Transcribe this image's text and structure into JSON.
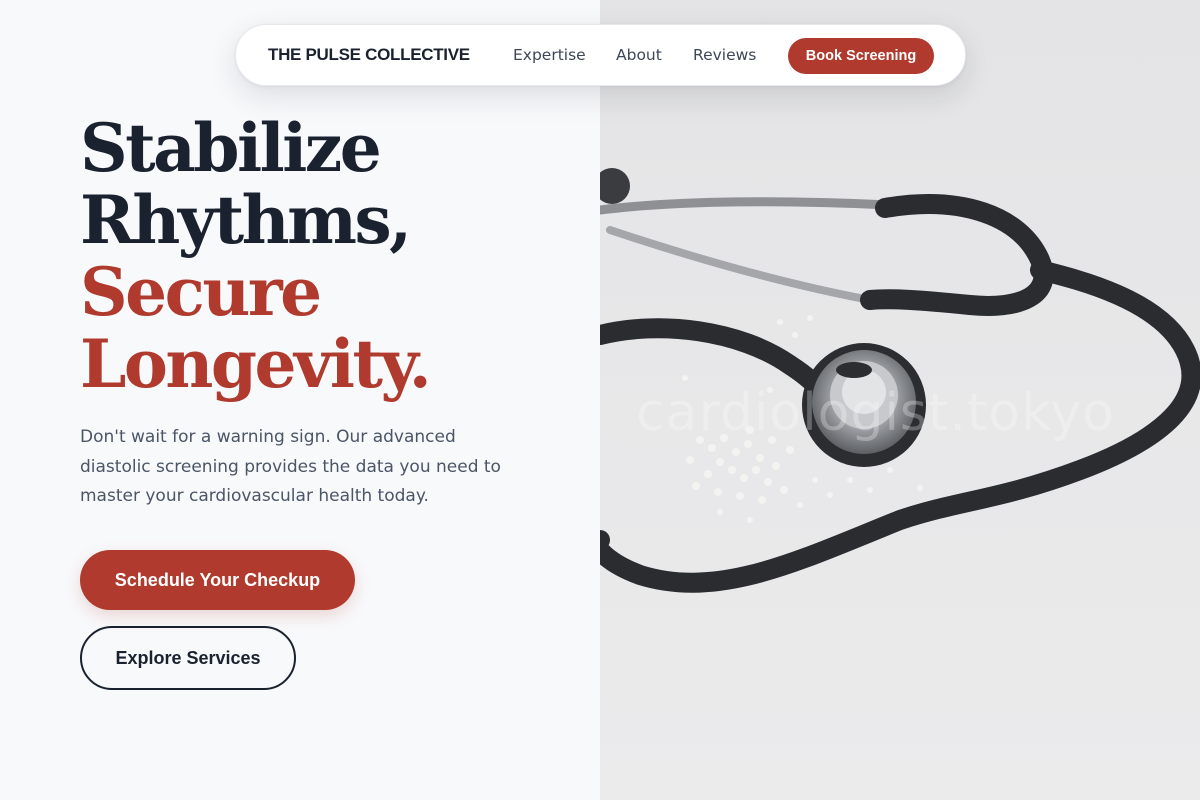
{
  "nav": {
    "brand": "THE PULSE COLLECTIVE",
    "links": [
      "Expertise",
      "About",
      "Reviews"
    ],
    "cta": "Book Screening"
  },
  "hero": {
    "headline_lines": [
      "Stabilize",
      "Rhythms,",
      "Secure",
      "Longevity."
    ],
    "subtext": "Don't wait for a warning sign. Our advanced diastolic screening provides the data you need to master your cardiovascular health today.",
    "primary_button": "Schedule Your Checkup",
    "secondary_button": "Explore Services"
  },
  "image": {
    "subject": "stethoscope-photo",
    "watermark": "cardiologist.tokyo"
  },
  "colors": {
    "accent": "#b03a2e",
    "dark": "#1a2230",
    "muted_text": "#4a5566",
    "background": "#f8f9fb"
  }
}
